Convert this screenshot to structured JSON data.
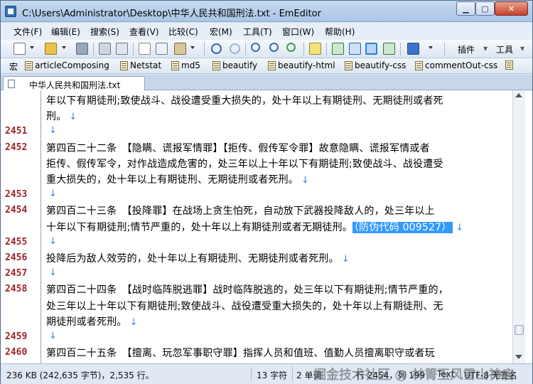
{
  "window": {
    "title": "C:\\Users\\Administrator\\Desktop\\中华人民共和国刑法.txt - EmEditor"
  },
  "menu": [
    "文件(F)",
    "编辑(E)",
    "搜索(S)",
    "查看(V)",
    "比较(C)",
    "宏(M)",
    "工具(T)",
    "窗口(W)",
    "帮助(H)"
  ],
  "toolbar": {
    "plugins_label": "插件",
    "tools_label": "工具"
  },
  "macrobar": {
    "label": "宏",
    "items": [
      "articleComposing",
      "Netstat",
      "md5",
      "beautify",
      "beautify-html",
      "beautify-css",
      "commentOut-css"
    ]
  },
  "tab": {
    "label": "中华人民共和国刑法.txt"
  },
  "editor": {
    "lines": [
      {
        "num": "",
        "text": "年以下有期徒刑;致使战斗、战役遭受重大损失的，处十年以上有期徒刑、无期徒刑或者死"
      },
      {
        "num": "",
        "text": "刑。",
        "mark": "↓"
      },
      {
        "num": "2451",
        "text": "",
        "mark": "↓"
      },
      {
        "num": "2452",
        "text": "第四百二十二条　【隐瞒、谎报军情罪】【拒传、假传军令罪】故意隐瞒、谎报军情或者"
      },
      {
        "num": "",
        "text": "拒传、假传军令，对作战造成危害的，处三年以上十年以下有期徒刑;致使战斗、战役遭受"
      },
      {
        "num": "",
        "text": "重大损失的，处十年以上有期徒刑、无期徒刑或者死刑。",
        "mark": "↓"
      },
      {
        "num": "2453",
        "text": "",
        "mark": "↓"
      },
      {
        "num": "2454",
        "text": "第四百二十三条　【投降罪】在战场上贪生怕死，自动放下武器投降敌人的，处三年以上"
      },
      {
        "num": "",
        "text": "十年以下有期徒刑;情节严重的，处十年以上有期徒刑或者无期徒刑。",
        "selected": "（防伪代码 009527）",
        "mark": "↓"
      },
      {
        "num": "2455",
        "text": "",
        "mark": "↓"
      },
      {
        "num": "2456",
        "text": "投降后为敌人效劳的，处十年以上有期徒刑、无期徒刑或者死刑。",
        "mark": "↓"
      },
      {
        "num": "2457",
        "text": "",
        "mark": "↓"
      },
      {
        "num": "2458",
        "text": "第四百二十四条　【战时临阵脱逃罪】战时临阵脱逃的，处三年以下有期徒刑;情节严重的，"
      },
      {
        "num": "",
        "text": "处三年以上十年以下有期徒刑;致使战斗、战役遭受重大损失的，处十年以上有期徒刑、无"
      },
      {
        "num": "",
        "text": "期徒刑或者死刑。",
        "mark": "↓"
      },
      {
        "num": "2459",
        "text": "",
        "mark": "↓"
      },
      {
        "num": "2460",
        "text": "第四百二十五条　【擅离、玩忽军事职守罪】指挥人员和值班、值勤人员擅离职守或者玩"
      }
    ]
  },
  "status": {
    "file_info": "236 KB (242,635 字节)，2,535 行。",
    "chars": "13 字符",
    "words": "2 单词",
    "position": "行 2454，列 199",
    "type": "Text",
    "encoding": "UTF-8 无签名"
  },
  "watermark": "掘金技术社区 @ 林箐玉风雪山神庙"
}
